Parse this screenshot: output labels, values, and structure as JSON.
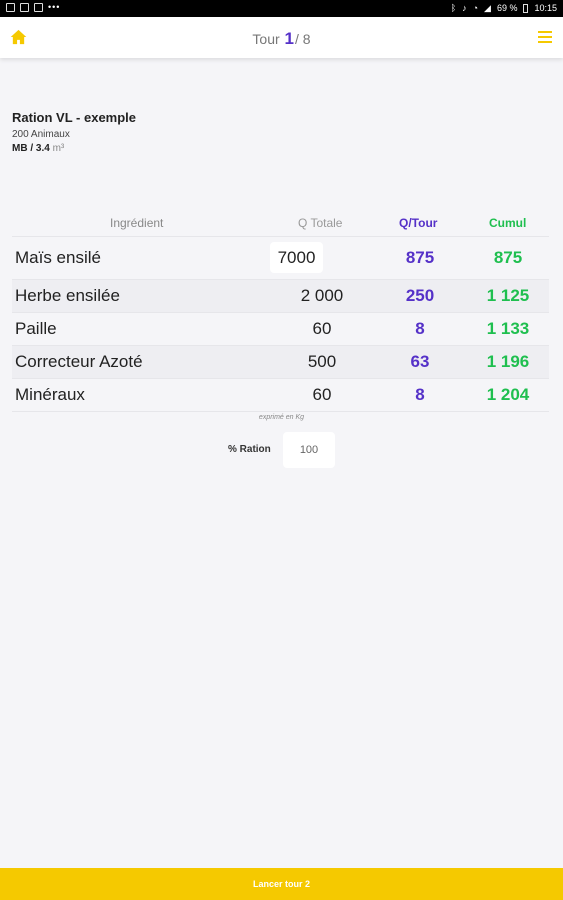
{
  "status_bar": {
    "battery": "69 %",
    "time": "10:15",
    "left_icons": [
      "gallery-icon",
      "image-icon",
      "flipboard-icon"
    ],
    "right_icons": [
      "bluetooth-icon",
      "mute-icon",
      "wifi-icon",
      "signal-icon",
      "battery-icon"
    ]
  },
  "header": {
    "title_prefix": "Tour",
    "current": "1",
    "separator": "/",
    "total": "8"
  },
  "ration": {
    "name": "Ration VL - exemple",
    "animals": "200 Animaux",
    "mb_label": "MB / 3.4",
    "mb_unit": "m³"
  },
  "table": {
    "headers": {
      "ingredient": "Ingrédient",
      "q_totale": "Q Totale",
      "q_tour": "Q/Tour",
      "cumul": "Cumul"
    },
    "rows": [
      {
        "name": "Maïs ensilé",
        "q_totale": "7000",
        "q_tour": "875",
        "cumul": "875"
      },
      {
        "name": "Herbe ensilée",
        "q_totale": "2 000",
        "q_tour": "250",
        "cumul": "1 125"
      },
      {
        "name": "Paille",
        "q_totale": "60",
        "q_tour": "8",
        "cumul": "1 133"
      },
      {
        "name": "Correcteur Azoté",
        "q_totale": "500",
        "q_tour": "63",
        "cumul": "1 196"
      },
      {
        "name": "Minéraux",
        "q_totale": "60",
        "q_tour": "8",
        "cumul": "1 204"
      }
    ]
  },
  "unit_note": "exprimé en Kg",
  "ration_percent": {
    "label": "% Ration",
    "value": "100"
  },
  "launch_button": "Lancer tour 2",
  "colors": {
    "accent_yellow": "#f5c900",
    "q_tour_purple": "#5531c8",
    "cumul_green": "#1fbf4f"
  }
}
